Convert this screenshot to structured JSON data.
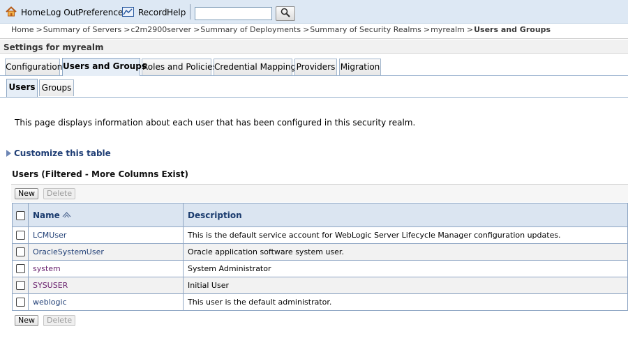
{
  "toolbar": {
    "home": "Home",
    "logout": "Log Out",
    "preferences": "Preferences",
    "record": "Record",
    "help": "Help",
    "search_value": ""
  },
  "breadcrumb": {
    "items": [
      "Home",
      "Summary of Servers",
      "c2m2900server",
      "Summary of Deployments",
      "Summary of Security Realms",
      "myrealm"
    ],
    "current": "Users and Groups",
    "separator": ">"
  },
  "settings_title": "Settings for myrealm",
  "tabs": [
    {
      "label": "Configuration"
    },
    {
      "label": "Users and Groups"
    },
    {
      "label": "Roles and Policies"
    },
    {
      "label": "Credential Mappings"
    },
    {
      "label": "Providers"
    },
    {
      "label": "Migration"
    }
  ],
  "subtabs": [
    {
      "label": "Users"
    },
    {
      "label": "Groups"
    }
  ],
  "description": "This page displays information about each user that has been configured in this security realm.",
  "customize_label": "Customize this table",
  "table": {
    "title": "Users (Filtered - More Columns Exist)",
    "new_label": "New",
    "delete_label": "Delete",
    "columns": [
      "Name",
      "Description"
    ],
    "rows": [
      {
        "name": "LCMUser",
        "description": "This is the default service account for WebLogic Server Lifecycle Manager configuration updates."
      },
      {
        "name": "OracleSystemUser",
        "description": "Oracle application software system user."
      },
      {
        "name": "system",
        "description": "System Administrator"
      },
      {
        "name": "SYSUSER",
        "description": "Initial User"
      },
      {
        "name": "weblogic",
        "description": "This user is the default administrator."
      }
    ]
  },
  "colors": {
    "accent": "#1f3e75",
    "header_bg": "#dbe5f1",
    "toolbar_bg": "#dde8f4",
    "visited": "#6b246f"
  },
  "icons": [
    "home-icon",
    "record-icon",
    "search-icon",
    "sort-ascending-icon",
    "expand-triangle-icon"
  ]
}
